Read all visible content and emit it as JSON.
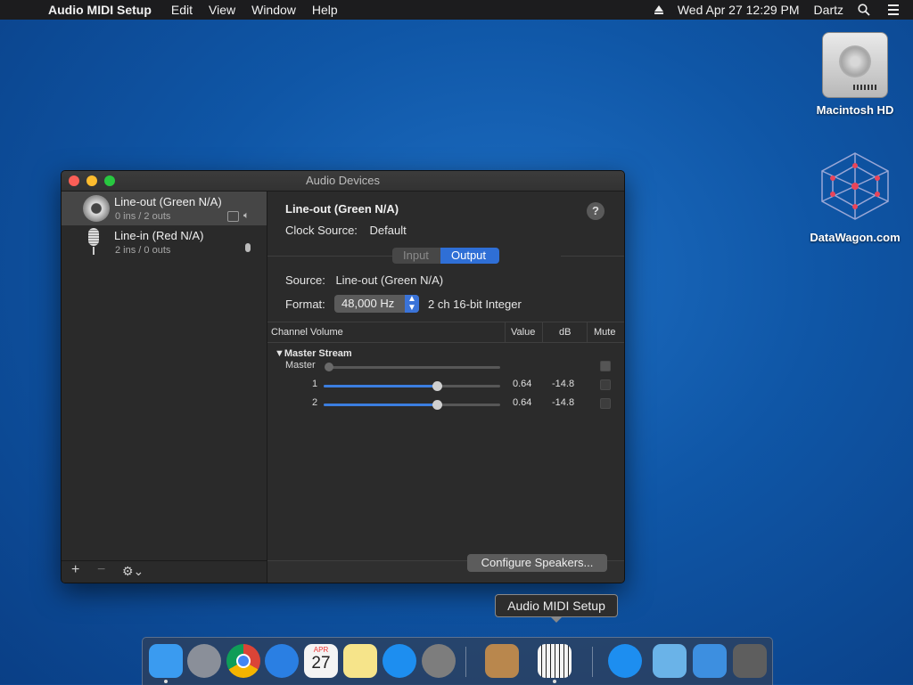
{
  "menubar": {
    "app_name": "Audio MIDI Setup",
    "menus": [
      "Edit",
      "View",
      "Window",
      "Help"
    ],
    "datetime": "Wed Apr 27  12:29 PM",
    "user": "Dartz"
  },
  "desktop": {
    "icons": [
      {
        "label": "Macintosh HD"
      },
      {
        "label": "DataWagon.com"
      }
    ]
  },
  "window": {
    "title": "Audio Devices",
    "devices": [
      {
        "name": "Line-out (Green N/A)",
        "sub": "0 ins / 2 outs",
        "selected": true
      },
      {
        "name": "Line-in (Red N/A)",
        "sub": "2 ins / 0 outs",
        "selected": false
      }
    ],
    "sidebar_footer": {
      "add": "+",
      "remove": "−",
      "gear": "⚙︎⌄"
    },
    "detail": {
      "title": "Line-out (Green N/A)",
      "clock_label": "Clock Source:",
      "clock_value": "Default",
      "help": "?",
      "tabs": {
        "input": "Input",
        "output": "Output",
        "active": "output"
      },
      "source_label": "Source:",
      "source_value": "Line-out (Green N/A)",
      "format_label": "Format:",
      "format_rate": "48,000 Hz",
      "format_desc": "2 ch 16-bit Integer",
      "table": {
        "headers": {
          "channel": "Channel Volume",
          "value": "Value",
          "db": "dB",
          "mute": "Mute"
        },
        "stream": "Master Stream",
        "rows": [
          {
            "label": "Master",
            "level": 0.0,
            "value": "",
            "db": ""
          },
          {
            "label": "1",
            "level": 0.64,
            "value": "0.64",
            "db": "-14.8"
          },
          {
            "label": "2",
            "level": 0.64,
            "value": "0.64",
            "db": "-14.8"
          }
        ]
      },
      "configure_button": "Configure Speakers..."
    }
  },
  "tooltip": "Audio MIDI Setup",
  "dock": {
    "items": [
      {
        "icon": "finder-icon",
        "color": "#3a9bf0",
        "running": true
      },
      {
        "icon": "launchpad-icon",
        "color": "#8a8f99",
        "running": false
      },
      {
        "icon": "chrome-icon",
        "color": "#e9e9e9",
        "running": false
      },
      {
        "icon": "safari-icon",
        "color": "#2a7fe3",
        "running": false
      },
      {
        "icon": "calendar-icon",
        "color": "#f4f4f4",
        "running": false
      },
      {
        "icon": "notes-icon",
        "color": "#f6e48a",
        "running": false
      },
      {
        "icon": "app-store-icon",
        "color": "#1d8ef0",
        "running": false
      },
      {
        "icon": "system-preferences-icon",
        "color": "#7d7d7d",
        "running": false
      },
      {
        "icon": "chess-icon",
        "color": "#b9874d",
        "running": false
      },
      {
        "icon": "audio-midi-setup-icon",
        "color": "#1b1b1b",
        "running": true
      },
      {
        "icon": "app-store-download-icon",
        "color": "#1d8ef0",
        "running": false
      },
      {
        "icon": "folder-icon",
        "color": "#6ab3e8",
        "running": false
      },
      {
        "icon": "downloads-folder-icon",
        "color": "#3d8fe0",
        "running": false
      },
      {
        "icon": "trash-icon",
        "color": "#5e5e5e",
        "running": false
      }
    ],
    "calendar_month": "APR",
    "calendar_day": "27"
  }
}
